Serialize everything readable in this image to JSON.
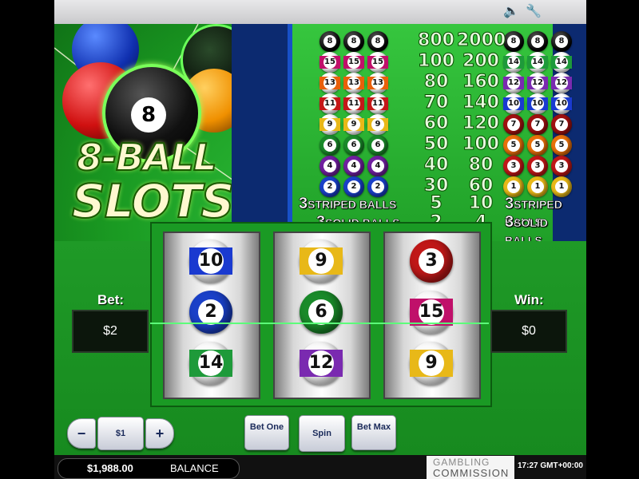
{
  "topbar": {
    "sound_icon": "speaker-icon",
    "settings_icon": "wrench-icon"
  },
  "logo": {
    "line1": "8-BALL",
    "line2": "SLOTS",
    "ball_number": "8"
  },
  "paytable": {
    "rows": [
      {
        "left": [
          "8",
          "8",
          "8"
        ],
        "left_type": "solid8",
        "pay1": "800",
        "pay2": "2000",
        "right": [
          "8",
          "8",
          "8"
        ],
        "right_type": "solid8"
      },
      {
        "left": [
          "15",
          "15",
          "15"
        ],
        "left_type": "stripe",
        "left_color": "#c0106a",
        "pay1": "100",
        "pay2": "200",
        "right": [
          "14",
          "14",
          "14"
        ],
        "right_type": "stripe",
        "right_color": "#1e9a3a"
      },
      {
        "left": [
          "13",
          "13",
          "13"
        ],
        "left_type": "stripe",
        "left_color": "#e8600a",
        "pay1": "80",
        "pay2": "160",
        "right": [
          "12",
          "12",
          "12"
        ],
        "right_type": "stripe",
        "right_color": "#7a2ab0"
      },
      {
        "left": [
          "11",
          "11",
          "11"
        ],
        "left_type": "stripe",
        "left_color": "#c41818",
        "pay1": "70",
        "pay2": "140",
        "right": [
          "10",
          "10",
          "10"
        ],
        "right_type": "stripe",
        "right_color": "#1a3ad0"
      },
      {
        "left": [
          "9",
          "9",
          "9"
        ],
        "left_type": "stripe",
        "left_color": "#e8b818",
        "pay1": "60",
        "pay2": "120",
        "right": [
          "7",
          "7",
          "7"
        ],
        "right_type": "solid",
        "right_color": "#a01010"
      },
      {
        "left": [
          "6",
          "6",
          "6"
        ],
        "left_type": "solid",
        "left_color": "#1a8a2a",
        "pay1": "50",
        "pay2": "100",
        "right": [
          "5",
          "5",
          "5"
        ],
        "right_type": "solid",
        "right_color": "#e8700a"
      },
      {
        "left": [
          "4",
          "4",
          "4"
        ],
        "left_type": "solid",
        "left_color": "#7020a0",
        "pay1": "40",
        "pay2": "80",
        "right": [
          "3",
          "3",
          "3"
        ],
        "right_type": "solid",
        "right_color": "#c01818"
      },
      {
        "left": [
          "2",
          "2",
          "2"
        ],
        "left_type": "solid",
        "left_color": "#1a40c8",
        "pay1": "30",
        "pay2": "60",
        "right": [
          "1",
          "1",
          "1"
        ],
        "right_type": "solid",
        "right_color": "#e8b818"
      }
    ],
    "striped": {
      "count": "3",
      "label": "STRIPED BALLS",
      "pay1": "5",
      "pay2": "10"
    },
    "solid": {
      "count": "3",
      "label": "SOLID BALLS",
      "pay1": "2",
      "pay2": "4"
    }
  },
  "reels": [
    [
      {
        "n": "10",
        "type": "stripe",
        "color": "#1a3ad0"
      },
      {
        "n": "2",
        "type": "solid",
        "color": "#1a40c8"
      },
      {
        "n": "14",
        "type": "stripe",
        "color": "#1e9a3a"
      }
    ],
    [
      {
        "n": "9",
        "type": "stripe",
        "color": "#e8b818"
      },
      {
        "n": "6",
        "type": "solid",
        "color": "#1a8a2a"
      },
      {
        "n": "12",
        "type": "stripe",
        "color": "#7a2ab0"
      }
    ],
    [
      {
        "n": "3",
        "type": "solid",
        "color": "#c01818"
      },
      {
        "n": "15",
        "type": "stripe",
        "color": "#c0106a"
      },
      {
        "n": "9",
        "type": "stripe",
        "color": "#e8b818"
      }
    ]
  ],
  "bet": {
    "label": "Bet:",
    "value": "$2"
  },
  "win": {
    "label": "Win:",
    "value": "$0"
  },
  "controls": {
    "minus": "−",
    "coin": "$1",
    "plus": "+",
    "bet_one": "Bet One",
    "spin": "Spin",
    "bet_max": "Bet Max"
  },
  "footer": {
    "balance_value": "$1,988.00",
    "balance_label": "BALANCE",
    "gc_line1": "GAMBLING",
    "gc_line2": "COMMISSION",
    "time": "17:27 GMT+00:00"
  }
}
